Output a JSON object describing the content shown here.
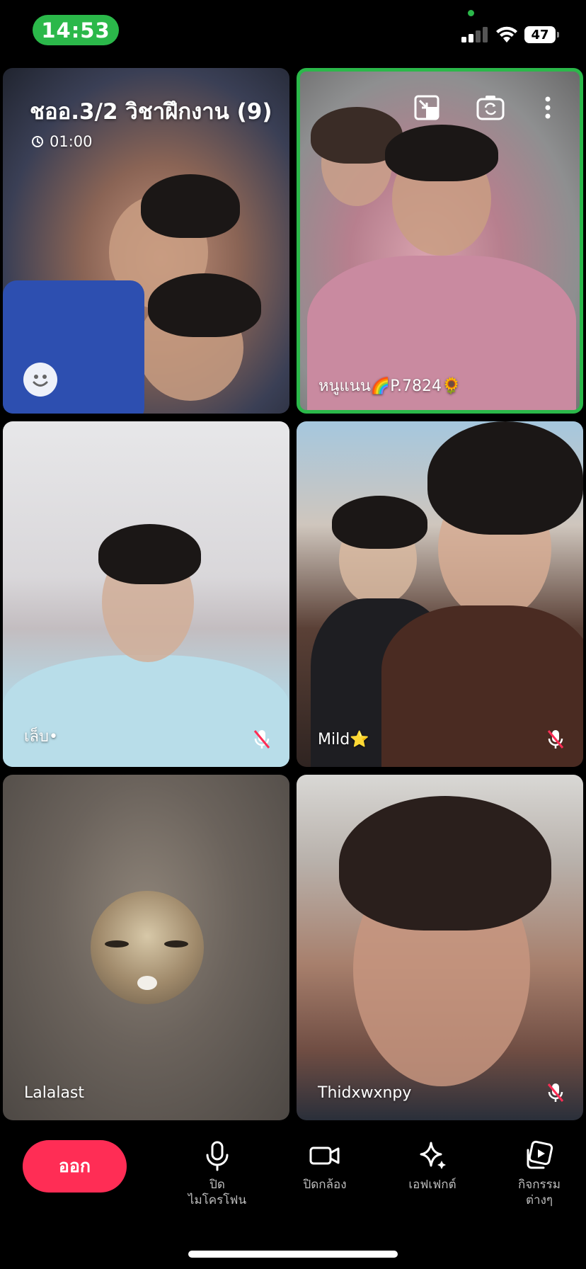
{
  "status_bar": {
    "time": "14:53",
    "battery": "47",
    "icons": [
      "signal-icon",
      "wifi-icon",
      "battery-icon"
    ]
  },
  "room": {
    "title": "ชออ.3/2 วิชาฝึกงาน (9)",
    "timer": "01:00"
  },
  "participants": [
    {
      "name": "",
      "muted": false
    },
    {
      "name": "หนูแนน🌈P.7824🌻",
      "muted": false,
      "speaking": true
    },
    {
      "name": "เล็บ•",
      "muted": true
    },
    {
      "name": "Mild⭐",
      "muted": true
    },
    {
      "name": "Lalalast",
      "muted": false
    },
    {
      "name": "Thidxwxnpy",
      "muted": true
    }
  ],
  "controls": {
    "leave": "ออก",
    "mic": "ปิด\nไมโครโฟน",
    "camera": "ปิดกล้อง",
    "effects": "เอฟเฟกต์",
    "activities": "กิจกรรม\nต่างๆ"
  },
  "colors": {
    "accent_green": "#2bb84a",
    "leave_red": "#ff2d55"
  }
}
